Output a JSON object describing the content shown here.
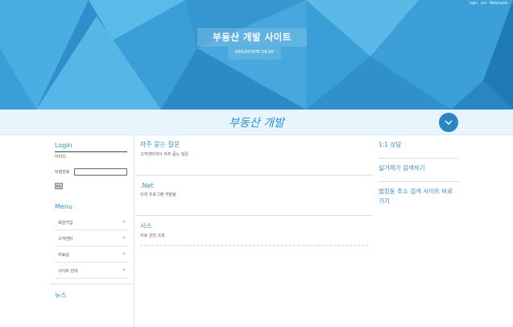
{
  "header": {
    "top_links": [
      "login",
      "join",
      "Webmaster"
    ],
    "site_title": "부동산 개발 사이트",
    "site_url": "REALESTATE DB.KR"
  },
  "subbar": {
    "title": "부동산 개발",
    "scroll_icon": "chevron-down-icon"
  },
  "sidebar": {
    "login_title": "Login",
    "id_label": "아이디",
    "password_label": "비밀번호",
    "login_button": "확인",
    "menu_title": "Menu",
    "menu_items": [
      {
        "label": "회원가입"
      },
      {
        "label": "고객센터"
      },
      {
        "label": "자료실"
      },
      {
        "label": "사이트 안내"
      }
    ],
    "news_title": "뉴스"
  },
  "posts": [
    {
      "title": "자주 묻는 질문",
      "subtitle": "고객센터에서 자주 묻는 질문"
    },
    {
      "title": ".Net",
      "subtitle": "닷넷 프로그램 개발팀"
    },
    {
      "title": "시스",
      "subtitle": "자료 관련 조회"
    }
  ],
  "right_links": [
    {
      "label": "1:1 상담"
    },
    {
      "label": "실거래가 검색하기"
    },
    {
      "label": "법정동 주소 검색 사이트 바로 가기"
    }
  ],
  "colors": {
    "accent": "#3b8fc3",
    "banner": "#3a9fd6",
    "button": "#2a86c3"
  }
}
